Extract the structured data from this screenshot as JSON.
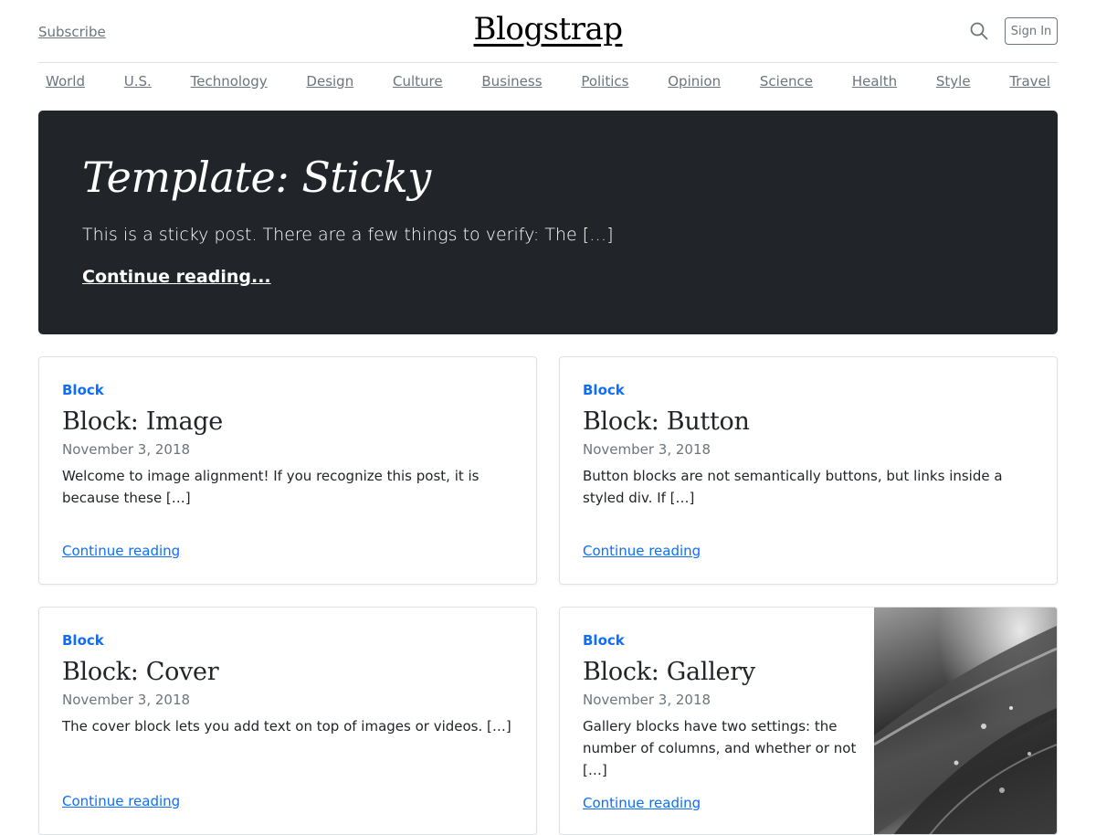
{
  "header": {
    "subscribe_label": "Subscribe",
    "logo": "Blogstrap",
    "signin_label": "Sign In"
  },
  "nav": {
    "items": [
      "World",
      "U.S.",
      "Technology",
      "Design",
      "Culture",
      "Business",
      "Politics",
      "Opinion",
      "Science",
      "Health",
      "Style",
      "Travel"
    ]
  },
  "hero": {
    "title": "Template: Sticky",
    "excerpt": "This is a sticky post. There are a few things to verify: The […]",
    "link_label": "Continue reading..."
  },
  "posts": [
    {
      "category": "Block",
      "title": "Block: Image",
      "date": "November 3, 2018",
      "excerpt": "Welcome to image alignment! If you recognize this post, it is because these […]",
      "link_label": "Continue reading"
    },
    {
      "category": "Block",
      "title": "Block: Button",
      "date": "November 3, 2018",
      "excerpt": "Button blocks are not semantically buttons, but links inside a styled div.  If […]",
      "link_label": "Continue reading"
    },
    {
      "category": "Block",
      "title": "Block: Cover",
      "date": "November 3, 2018",
      "excerpt": "The cover block lets you add text on top of images or videos. […]",
      "link_label": "Continue reading"
    },
    {
      "category": "Block",
      "title": "Block: Gallery",
      "date": "November 3, 2018",
      "excerpt": "Gallery blocks have two settings: the number of columns, and whether or not […]",
      "link_label": "Continue reading"
    }
  ],
  "colors": {
    "accent": "#0d6efd",
    "hero_bg": "#212529",
    "muted": "#6c757d"
  },
  "icons": {
    "search": "search-icon"
  }
}
